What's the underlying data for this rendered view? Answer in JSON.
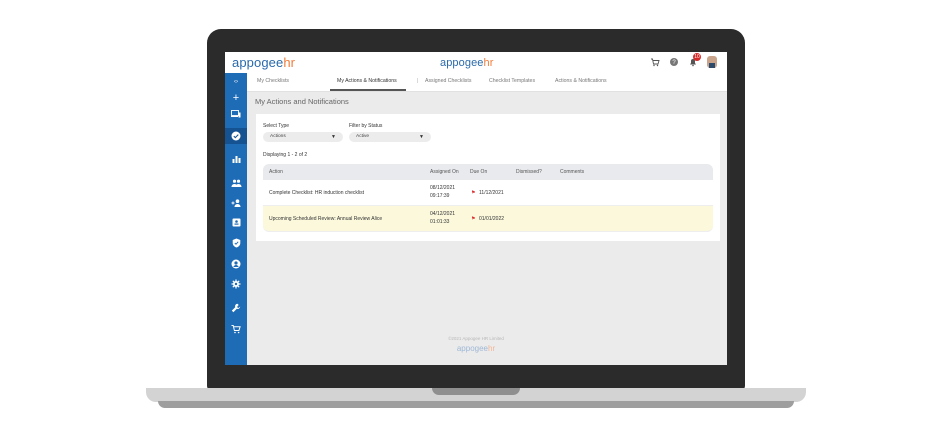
{
  "brand": {
    "logo_a": "appogee",
    "logo_b": "hr"
  },
  "topbar": {
    "icons": [
      "cart-icon",
      "help-icon",
      "bell-icon",
      "avatar"
    ],
    "notification_count": "10"
  },
  "sidebar": {
    "icons": [
      "collapse-icon",
      "plus-icon",
      "devices-icon",
      "check-circle-icon",
      "bar-chart-icon",
      "people-icon",
      "add-person-icon",
      "badge-icon",
      "shield-icon",
      "account-icon",
      "gear-icon",
      "wrench-icon",
      "cart-icon"
    ],
    "active": "check-circle-icon"
  },
  "tabs": [
    {
      "label": "My Checklists"
    },
    {
      "label": "My Actions & Notifications",
      "active": true
    },
    {
      "label": "Assigned Checklists"
    },
    {
      "label": "Checklist Templates"
    },
    {
      "label": "Actions & Notifications"
    }
  ],
  "page": {
    "title": "My Actions and Notifications",
    "select_type_label": "Select Type",
    "select_type_value": "Actions",
    "filter_status_label": "Filter by Status",
    "filter_status_value": "Active",
    "displaying": "Displaying 1 - 2 of 2"
  },
  "table": {
    "columns": [
      "Action",
      "Assigned On",
      "Due On",
      "Dismissed?",
      "Comments"
    ],
    "rows": [
      {
        "action": "Complete Checklist: HR induction checklist",
        "assigned_date": "08/12/2021",
        "assigned_time": "09:17:39",
        "due": "11/12/2021",
        "highlight": false
      },
      {
        "action": "Upcoming Scheduled Review: Annual Review Alice",
        "assigned_date": "04/12/2021",
        "assigned_time": "01:01:33",
        "due": "01/01/2022",
        "highlight": true
      }
    ]
  },
  "footer": {
    "copyright": "©2021 Appogee HR Limited",
    "logo_a": "appogee",
    "logo_b": "hr"
  },
  "colors": {
    "brand_blue": "#1e6bb6",
    "brand_orange": "#f07c3a",
    "highlight": "#fbf8dc"
  }
}
